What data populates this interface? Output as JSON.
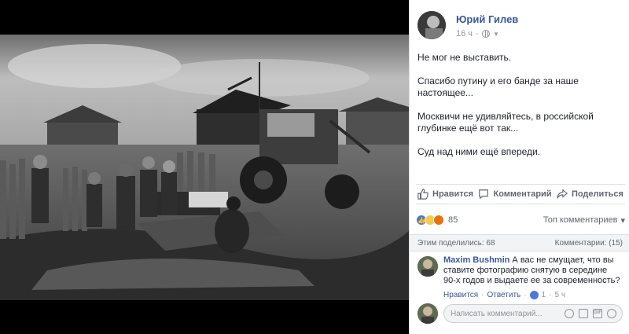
{
  "post": {
    "author": "Юрий Гилев",
    "time": "16 ч",
    "paragraphs": [
      "Не мог не выставить.",
      "Спасибо путину и его банде за наше настоящее...",
      "Москвичи не удивляйтесь, в российской глубинке ещё вот так...",
      "Суд над ними ещё впереди."
    ]
  },
  "actions": {
    "like": "Нравится",
    "comment": "Комментарий",
    "share": "Поделиться"
  },
  "reactions": {
    "count": "85",
    "top_comments": "Топ комментариев"
  },
  "stats": {
    "shares": "Этим поделились: 68",
    "comments": "Комментарии: (15)"
  },
  "comment": {
    "author": "Maxim Bushmin",
    "text": "А вас не смущает, что вы ставите фотографию снятую в середине 90-х годов и выдаете ее за современность?",
    "like": "Нравится",
    "reply": "Ответить",
    "likes": "1",
    "time": "5 ч"
  },
  "composer": {
    "placeholder": "Написать комментарий..."
  },
  "colors": {
    "link": "#385898",
    "muted": "#90949c",
    "like_blue": "#4b78d8"
  }
}
